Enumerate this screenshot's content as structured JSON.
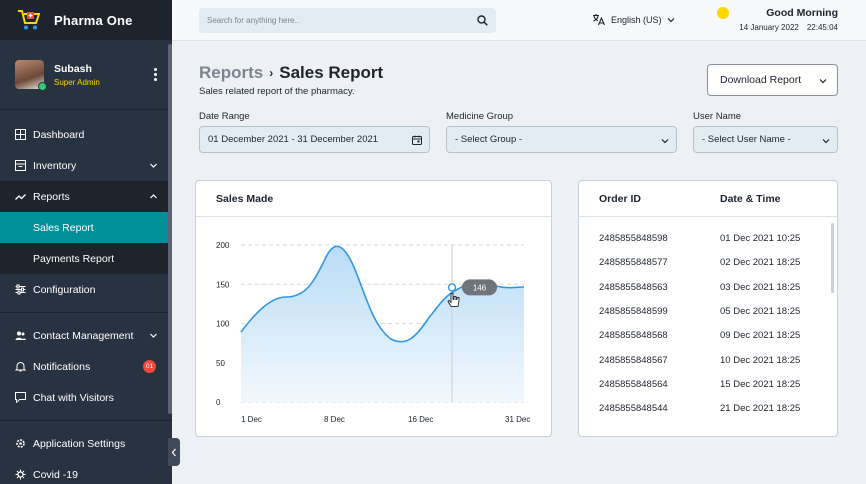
{
  "app": {
    "name": "Pharma One"
  },
  "user": {
    "name": "Subash",
    "role": "Super Admin"
  },
  "nav": {
    "dashboard": "Dashboard",
    "inventory": "Inventory",
    "reports": "Reports",
    "sales_report": "Sales Report",
    "payments_report": "Payments Report",
    "configuration": "Configuration",
    "contact_management": "Contact Management",
    "notifications": "Notifications",
    "notifications_badge": "01",
    "chat": "Chat with Visitors",
    "app_settings": "Application Settings",
    "covid": "Covid -19"
  },
  "header": {
    "search_placeholder": "Search for anything here..",
    "language": "English (US)",
    "greeting": "Good Morning",
    "date": "14 January 2022",
    "time": "22:45:04"
  },
  "page": {
    "crumb_parent": "Reports",
    "crumb_sep": "›",
    "title": "Sales Report",
    "subtitle": "Sales related report of the pharmacy.",
    "download_label": "Download Report"
  },
  "filters": {
    "date_label": "Date Range",
    "date_value": "01 December 2021 - 31 December 2021",
    "group_label": "Medicine Group",
    "group_value": "- Select Group -",
    "user_label": "User Name",
    "user_value": "- Select User Name -"
  },
  "sales_card": {
    "title": "Sales Made"
  },
  "chart_data": {
    "type": "area",
    "title": "Sales Made",
    "y_ticks": [
      "200",
      "150",
      "100",
      "50",
      "0"
    ],
    "x_ticks": [
      "1 Dec",
      "8 Dec",
      "16 Dec",
      "31 Dec"
    ],
    "ylim": [
      0,
      200
    ],
    "grid": true,
    "tooltip": {
      "label": "146",
      "value": 146
    },
    "line_color": "#3196e6"
  },
  "orders": {
    "col_id": "Order ID",
    "col_dt": "Date & Time",
    "rows": [
      {
        "id": "2485855848598",
        "dt": "01 Dec 2021  10:25"
      },
      {
        "id": "2485855848577",
        "dt": "02 Dec 2021  18:25"
      },
      {
        "id": "2485855848563",
        "dt": "03 Dec 2021  18:25"
      },
      {
        "id": "2485855848599",
        "dt": "05 Dec 2021  18:25"
      },
      {
        "id": "2485855848568",
        "dt": "09 Dec 2021  18:25"
      },
      {
        "id": "2485855848567",
        "dt": "10 Dec 2021  18:25"
      },
      {
        "id": "2485855848564",
        "dt": "15 Dec 2021  18:25"
      },
      {
        "id": "2485855848544",
        "dt": "21 Dec 2021  18:25"
      }
    ]
  }
}
